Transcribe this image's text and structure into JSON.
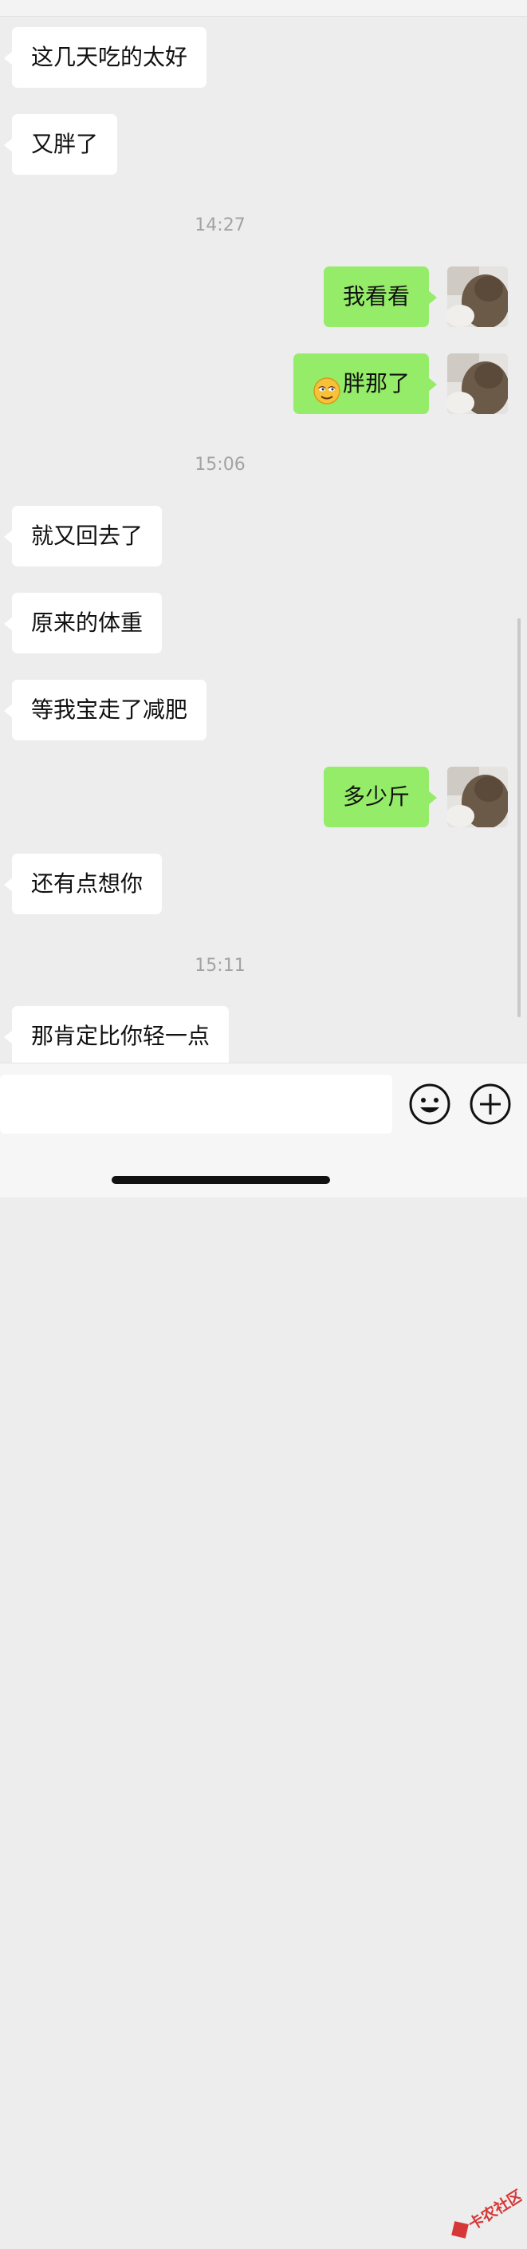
{
  "chat": {
    "messages": [
      {
        "side": "in",
        "text": "这几天吃的太好"
      },
      {
        "side": "in",
        "text": "又胖了"
      },
      {
        "type": "time",
        "text": "14:27"
      },
      {
        "side": "out",
        "text": "我看看"
      },
      {
        "side": "out",
        "text": "胖那了",
        "emoji": "smirk-face-icon"
      },
      {
        "type": "time",
        "text": "15:06"
      },
      {
        "side": "in",
        "text": "就又回去了"
      },
      {
        "side": "in",
        "text": "原来的体重"
      },
      {
        "side": "in",
        "text": "等我宝走了减肥"
      },
      {
        "side": "out",
        "text": "多少斤"
      },
      {
        "side": "in",
        "text": "还有点想你"
      },
      {
        "type": "time",
        "text": "15:11"
      },
      {
        "side": "in",
        "text": "那肯定比你轻一点"
      }
    ]
  },
  "inputbar": {
    "input_value": "",
    "icons": [
      "emoji-button-icon",
      "plus-button-icon"
    ]
  },
  "watermark": {
    "text": "卡农社区"
  },
  "colors": {
    "background": "#ededed",
    "incoming": "#ffffff",
    "outgoing": "#95ec69",
    "time": "#a3a3a3"
  }
}
